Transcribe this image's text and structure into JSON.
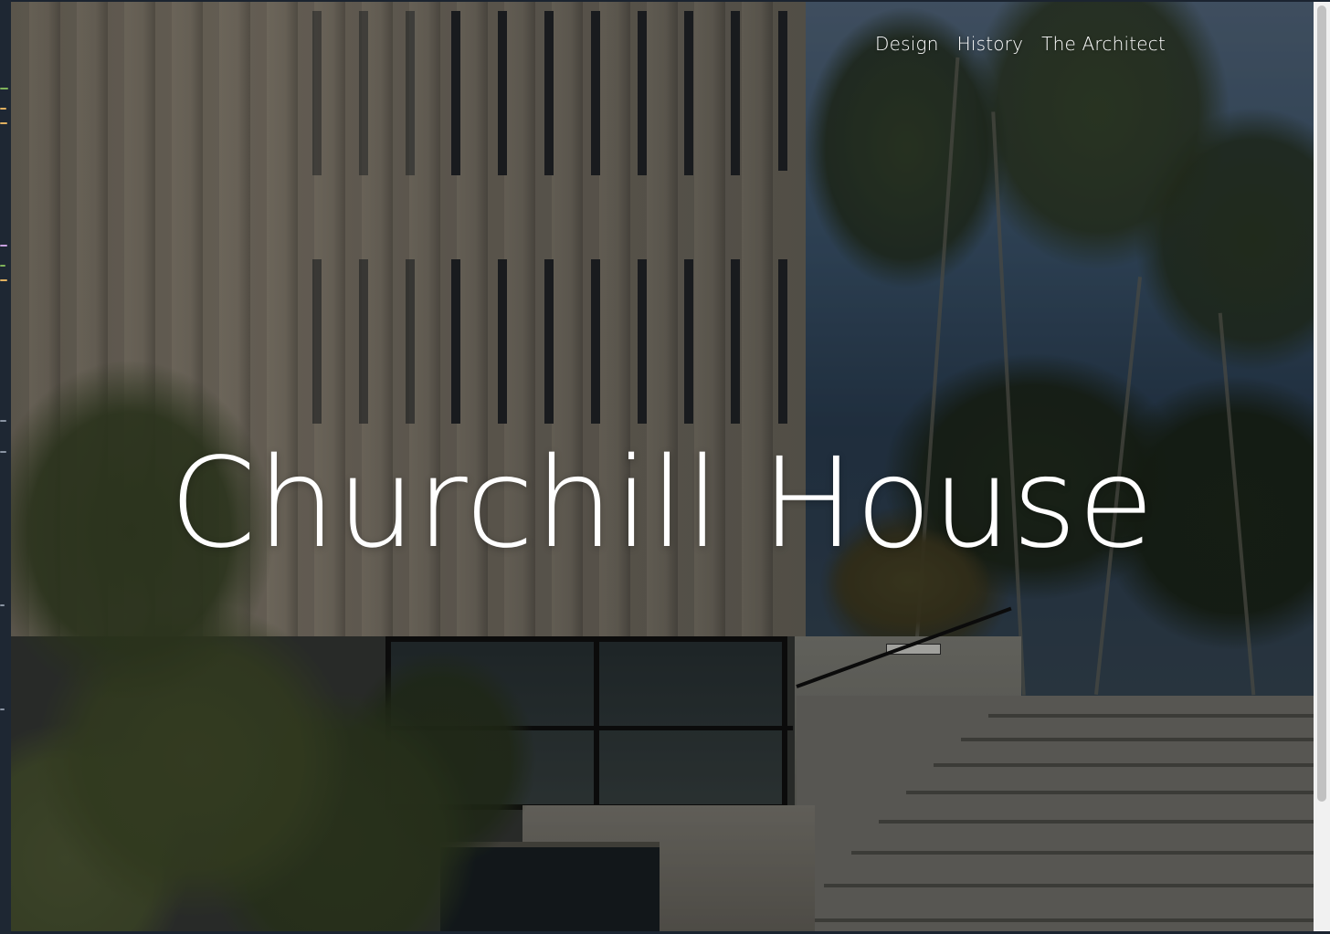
{
  "page": {
    "nav": {
      "items": [
        {
          "label": "Design"
        },
        {
          "label": "History"
        },
        {
          "label": "The Architect"
        }
      ]
    },
    "hero": {
      "title": "Churchill House",
      "image_icon": "building-photo"
    }
  },
  "colors": {
    "text": "#ffffff",
    "overlay": "rgba(0,0,0,0.30)",
    "frame": "#1b2430",
    "scrollbar_track": "#f1f1f1",
    "scrollbar_thumb": "#c1c1c1"
  }
}
